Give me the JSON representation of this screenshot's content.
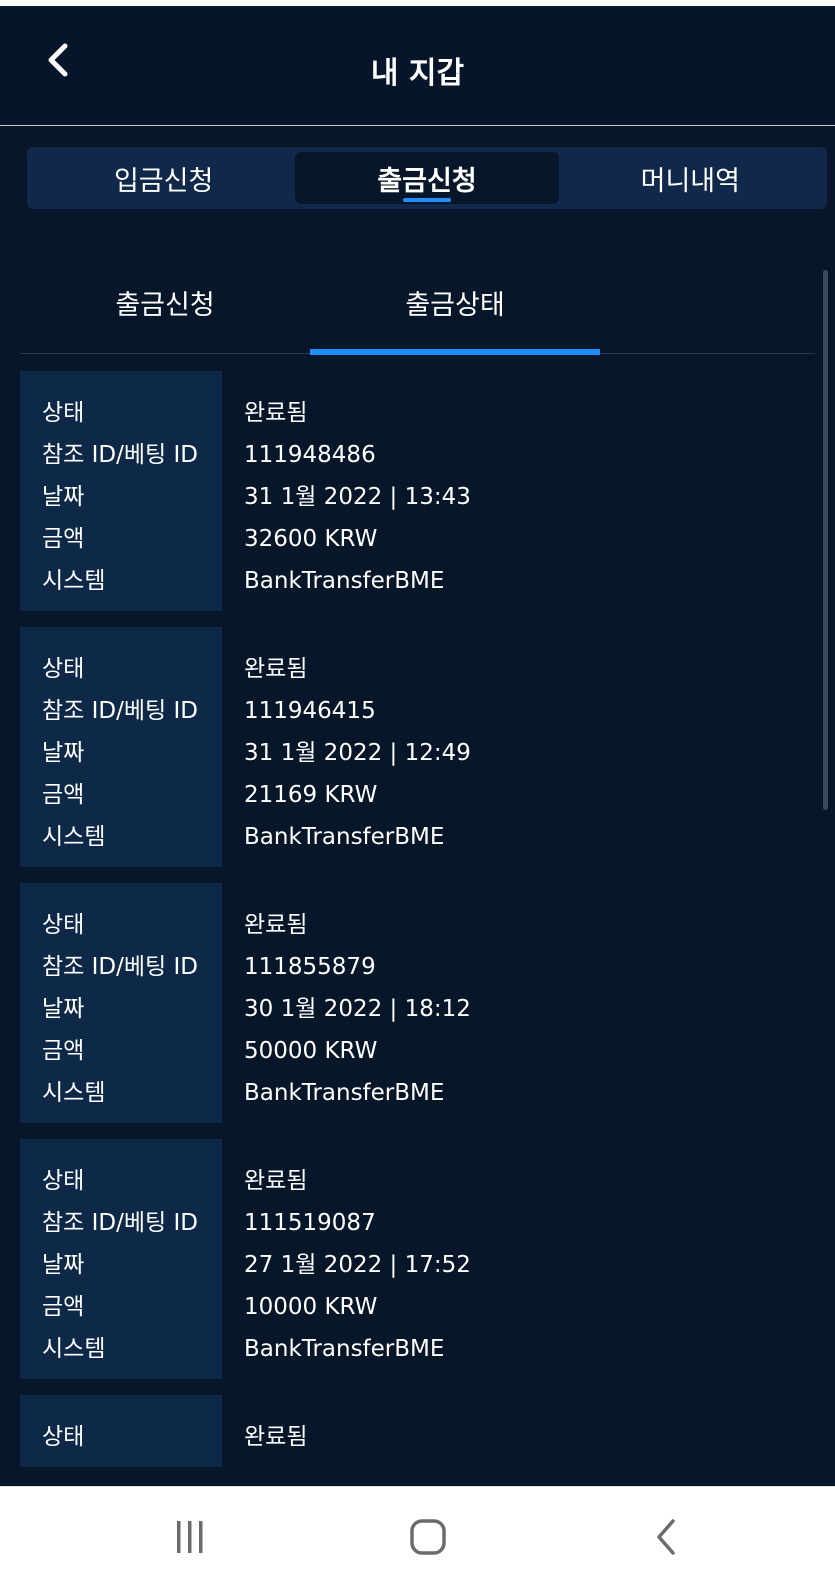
{
  "header": {
    "title": "내 지갑"
  },
  "main_tabs": [
    {
      "label": "입금신청",
      "active": false
    },
    {
      "label": "출금신청",
      "active": true
    },
    {
      "label": "머니내역",
      "active": false
    }
  ],
  "sub_tabs": [
    {
      "label": "출금신청",
      "active": false
    },
    {
      "label": "출금상태",
      "active": true
    }
  ],
  "field_labels": {
    "status": "상태",
    "reference": "참조 ID/베팅 ID",
    "date": "날짜",
    "amount": "금액",
    "system": "시스템"
  },
  "records": [
    {
      "status": "완료됨",
      "reference": "111948486",
      "date": "31 1월 2022 | 13:43",
      "amount": "32600 KRW",
      "system": "BankTransferBME"
    },
    {
      "status": "완료됨",
      "reference": "111946415",
      "date": "31 1월 2022 | 12:49",
      "amount": "21169 KRW",
      "system": "BankTransferBME"
    },
    {
      "status": "완료됨",
      "reference": "111855879",
      "date": "30 1월 2022 | 18:12",
      "amount": "50000 KRW",
      "system": "BankTransferBME"
    },
    {
      "status": "완료됨",
      "reference": "111519087",
      "date": "27 1월 2022 | 17:52",
      "amount": "10000 KRW",
      "system": "BankTransferBME"
    },
    {
      "status": "완료됨"
    }
  ],
  "colors": {
    "background": "#071628",
    "label_panel": "#0e2948",
    "accent": "#1f8fff",
    "text": "#ffffff"
  },
  "icons": {
    "back": "chevron-left-icon",
    "nav_recents": "recent-apps-icon",
    "nav_home": "home-icon",
    "nav_back": "back-arrow-icon"
  }
}
